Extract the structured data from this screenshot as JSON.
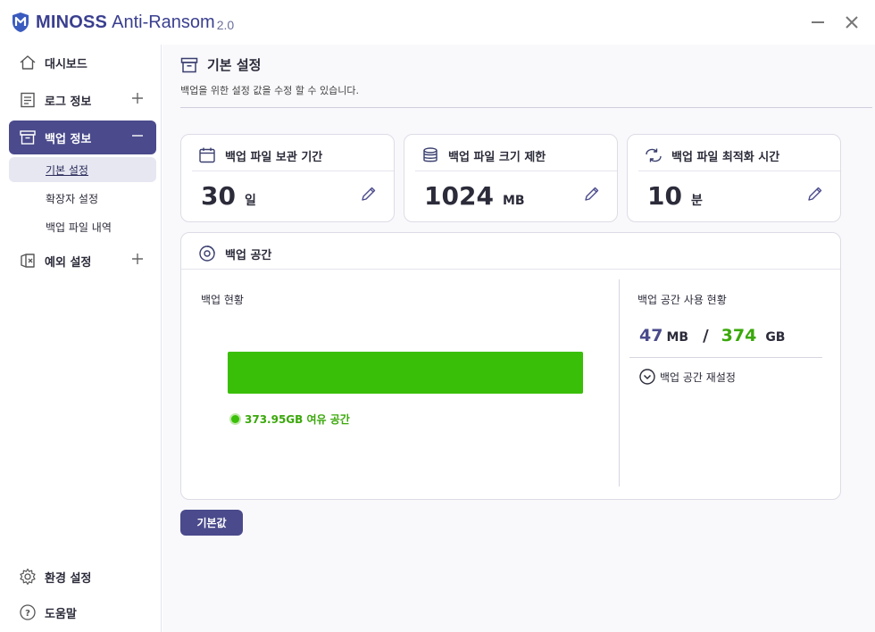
{
  "app": {
    "brand": "MINOSS",
    "product": "Anti-Ransom",
    "version": "2.0"
  },
  "sidebar": {
    "items": [
      {
        "label": "대시보드",
        "icon": "home-icon"
      },
      {
        "label": "로그 정보",
        "icon": "log-icon"
      },
      {
        "label": "백업 정보",
        "icon": "backup-icon"
      },
      {
        "label": "예외 설정",
        "icon": "exception-icon"
      }
    ],
    "sub_items": [
      {
        "label": "기본 설정"
      },
      {
        "label": "확장자 설정"
      },
      {
        "label": "백업 파일 내역"
      }
    ],
    "bottom": [
      {
        "label": "환경 설정",
        "icon": "gear-icon"
      },
      {
        "label": "도움말",
        "icon": "help-icon"
      }
    ]
  },
  "page": {
    "title": "기본 설정",
    "description": "백업을 위한 설정 값을 수정 할 수 있습니다."
  },
  "cards": [
    {
      "title": "백업 파일 보관 기간",
      "value": "30",
      "unit": "일",
      "icon": "calendar-icon"
    },
    {
      "title": "백업 파일 크기 제한",
      "value": "1024",
      "unit": "MB",
      "icon": "database-icon"
    },
    {
      "title": "백업 파일 최적화 시간",
      "value": "10",
      "unit": "분",
      "icon": "sync-icon"
    }
  ],
  "space": {
    "title": "백업 공간",
    "status_label": "백업 현황",
    "free_note": "373.95GB 여유 공간",
    "usage_label": "백업 공간 사용 현황",
    "used_value": "47",
    "used_unit": "MB",
    "separator": "/",
    "total_value": "374",
    "total_unit": "GB",
    "reset_label": "백업 공간 재설정",
    "free_fraction": 0.9999,
    "bar_color": "#3abf08"
  },
  "buttons": {
    "default_label": "기본값"
  },
  "colors": {
    "accent": "#4a4a8c",
    "green": "#3abf08",
    "green_text": "#3aa80a"
  }
}
